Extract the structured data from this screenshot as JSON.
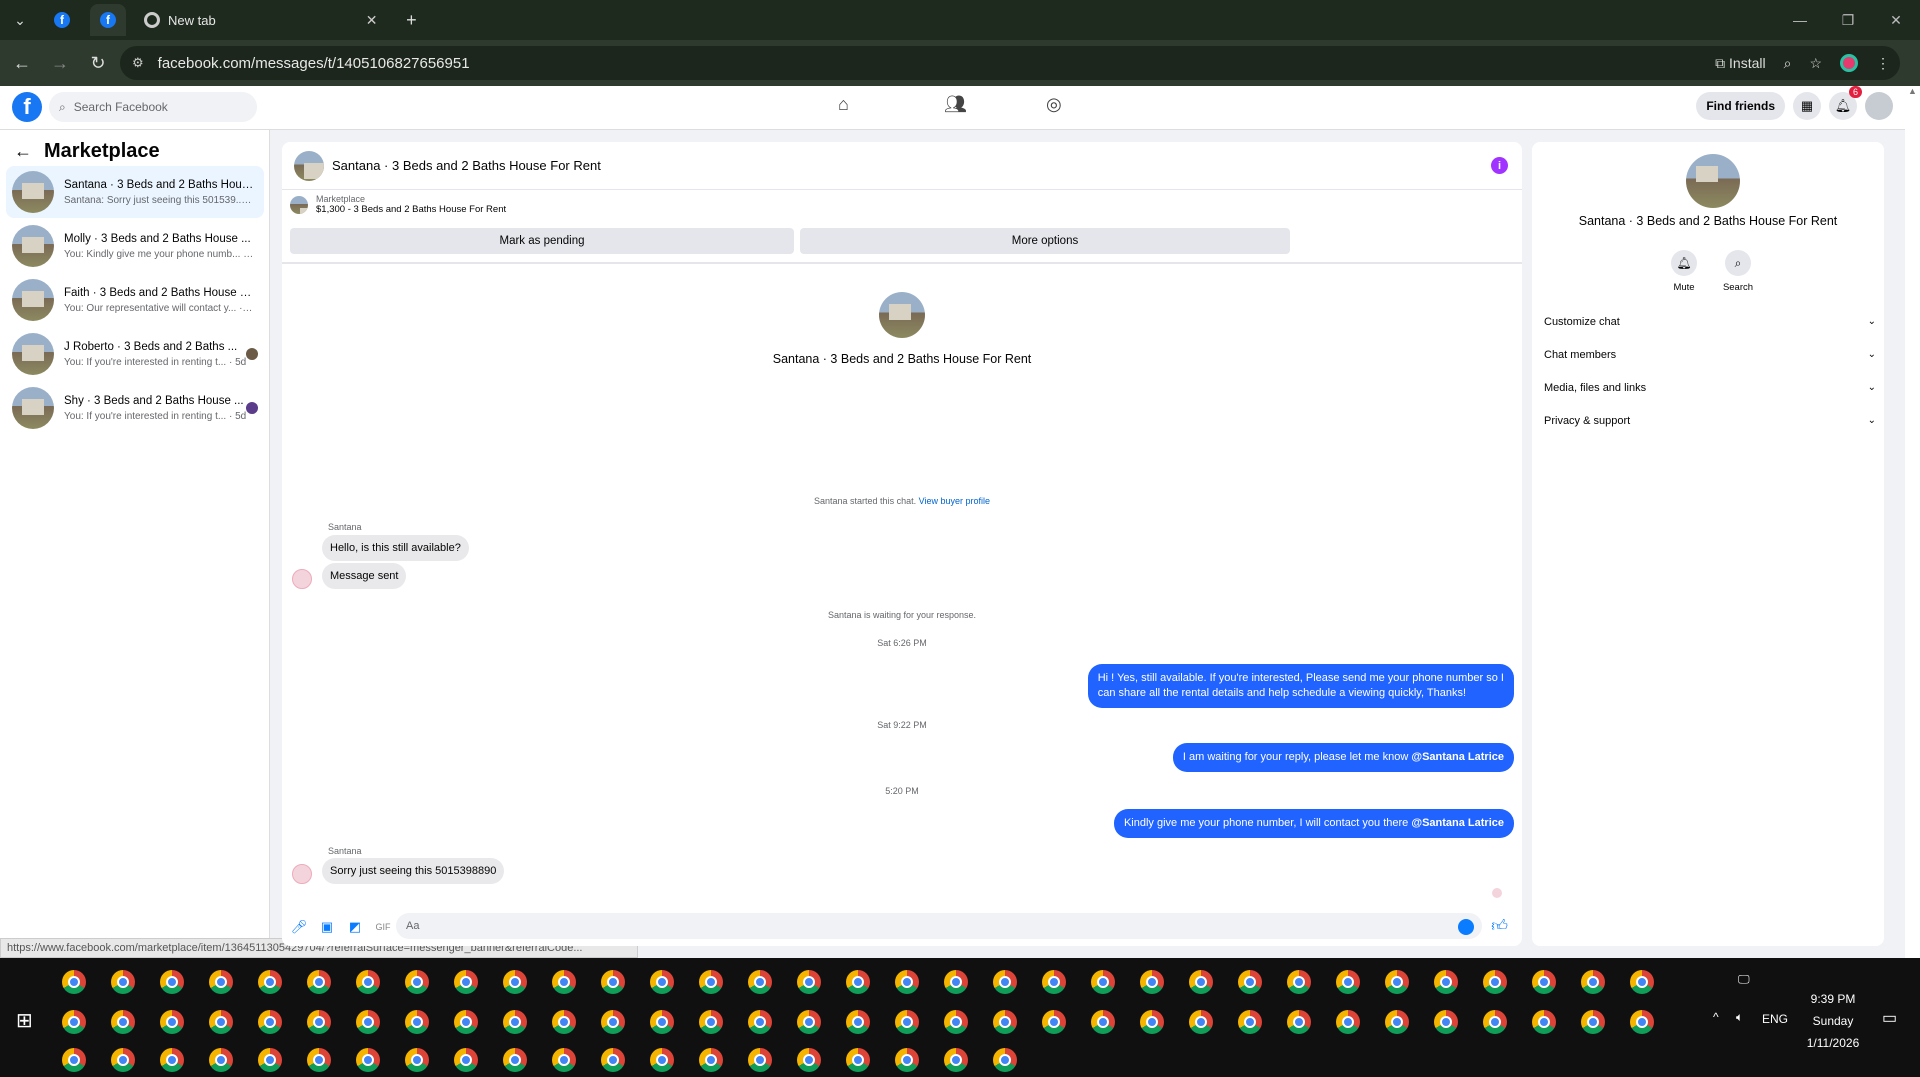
{
  "browser": {
    "tabs": [
      {
        "label": ""
      },
      {
        "label": ""
      },
      {
        "label": "New tab"
      }
    ],
    "url": "facebook.com/messages/t/1405106827656951",
    "install_label": "Install"
  },
  "fb_header": {
    "search_placeholder": "Search Facebook",
    "find_friends": "Find friends",
    "notif_count": "6"
  },
  "sidebar": {
    "title": "Marketplace",
    "conversations": [
      {
        "name": "Santana · 3 Beds and 2 Baths Hous...",
        "preview": "Santana: Sorry just seeing this 501539... · 4h",
        "selected": true
      },
      {
        "name": "Molly · 3 Beds and 2 Baths House ...",
        "preview": "You: Kindly give me your phone numb... · 4h"
      },
      {
        "name": "Faith · 3 Beds and 2 Baths House F...",
        "preview": "You: Our representative will contact y... · 1d"
      },
      {
        "name": "J Roberto · 3 Beds and 2 Baths ...",
        "preview": "You: If you're interested in renting t... · 5d"
      },
      {
        "name": "Shy · 3 Beds and 2 Baths House ...",
        "preview": "You: If you're interested in renting t... · 5d"
      }
    ],
    "status_url": "https://www.facebook.com/marketplace/item/1364511305429704/?referralSurface=messenger_banner&referralCode..."
  },
  "chat": {
    "title": "Santana · 3 Beds and 2 Baths House For Rent",
    "marketplace_label": "Marketplace",
    "listing": "$1,300 - 3 Beds and 2 Baths House For Rent",
    "mark_pending": "Mark as pending",
    "more_options": "More options",
    "profile_name": "Santana · 3 Beds and 2 Baths House For Rent",
    "started_note": "Santana started this chat.",
    "view_profile": "View buyer profile",
    "sender_1": "Santana",
    "msg_in_1": "Hello, is this still available?",
    "msg_in_2": "Message sent",
    "waiting_note": "Santana is waiting for your response.",
    "time_1": "Sat 6:26 PM",
    "msg_out_1a": "Hi ! Yes, still available. If you're interested, Please send me your phone number so I",
    "msg_out_1b": "can share all the rental details and help schedule a viewing quickly, Thanks!",
    "time_2": "Sat 9:22 PM",
    "msg_out_2": "I am waiting for your reply, please let me know ",
    "mention": "@Santana Latrice",
    "time_3": "5:20 PM",
    "msg_out_3": "Kindly give me your phone number, I will contact you there ",
    "sender_2": "Santana",
    "msg_in_3": "Sorry just seeing this 5015398890",
    "composer_placeholder": "Aa"
  },
  "right_panel": {
    "name": "Santana · 3 Beds and 2 Baths House For Rent",
    "mute": "Mute",
    "search": "Search",
    "rows": [
      "Customize chat",
      "Chat members",
      "Media, files and links",
      "Privacy & support"
    ]
  },
  "taskbar": {
    "time": "9:39 PM",
    "day": "Sunday",
    "date": "1/11/2026",
    "lang": "ENG"
  },
  "colors": {
    "accent": "#1877f2",
    "bubble_out": "#2063ff",
    "info": "#a033ff"
  }
}
